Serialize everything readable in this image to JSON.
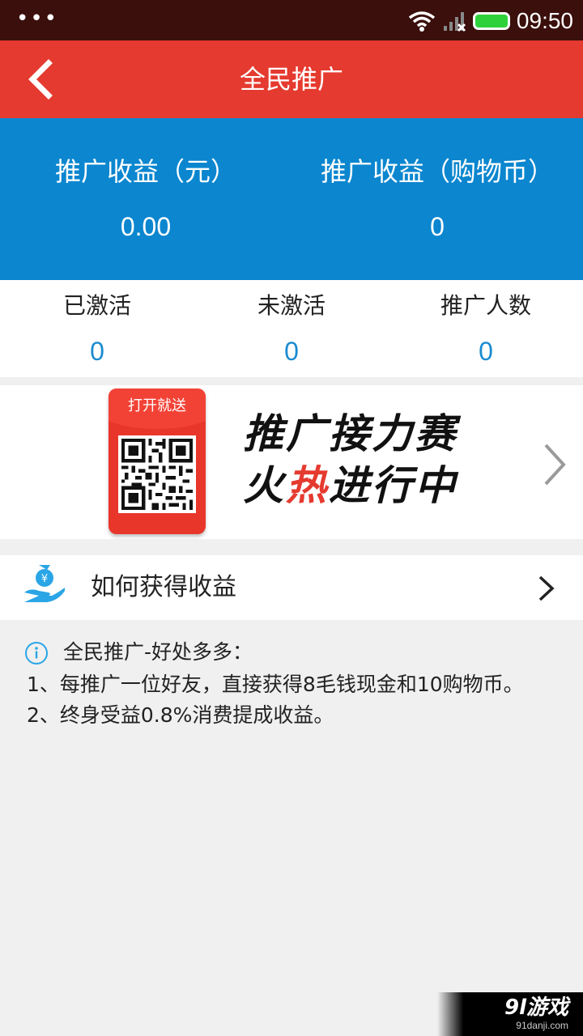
{
  "status_bar": {
    "dots": "•••",
    "time": "09:50",
    "icons": [
      "wifi-icon",
      "signal-icon",
      "battery-icon"
    ]
  },
  "header": {
    "title": "全民推广",
    "back_icon": "chevron-left-icon"
  },
  "earnings": {
    "cash_label": "推广收益（元）",
    "cash_value": "0.00",
    "coin_label": "推广收益（购物币）",
    "coin_value": "0"
  },
  "stats": [
    {
      "label": "已激活",
      "value": "0"
    },
    {
      "label": "未激活",
      "value": "0"
    },
    {
      "label": "推广人数",
      "value": "0"
    }
  ],
  "banner": {
    "envelope_text": "打开就送",
    "heading_line1": "推广接力赛",
    "heading_line2_a": "火",
    "heading_line2_hot": "热",
    "heading_line2_b": "进行中",
    "arrow_icon": "chevron-right-icon"
  },
  "earn_link": {
    "label": "如何获得收益",
    "icon": "money-hand-icon"
  },
  "info": {
    "title": "全民推广-好处多多：",
    "lines": [
      "1、每推广一位好友，直接获得8毛钱现金和10购物币。",
      "2、终身受益0.8%消费提成收益。"
    ]
  },
  "watermark": {
    "main": "9l游戏",
    "sub": "91danji.com"
  },
  "colors": {
    "header_red": "#e53a2f",
    "panel_blue": "#0b86cf",
    "stat_blue": "#1a8bd0",
    "page_gray": "#f0f0f0"
  }
}
